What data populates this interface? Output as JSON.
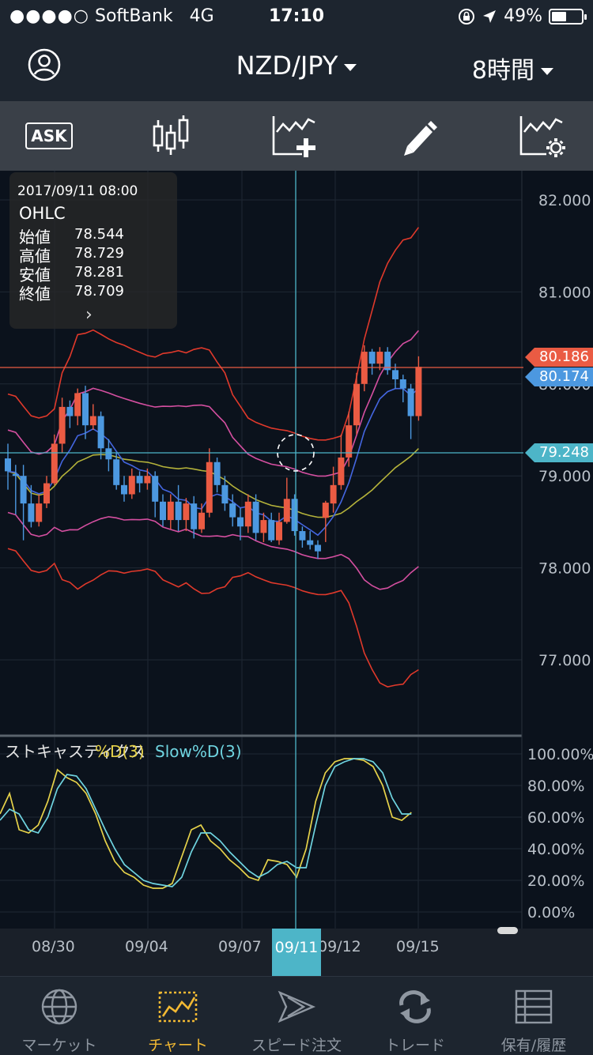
{
  "status": {
    "signal_dots": "●●●●○",
    "carrier": "SoftBank",
    "network": "4G",
    "time": "17:10",
    "battery": "49%",
    "battery_level": 0.49
  },
  "nav": {
    "pair": "NZD/JPY",
    "period": "8時間"
  },
  "toolbar": {
    "ask_label": "ASK"
  },
  "ohlc": {
    "datetime": "2017/09/11 08:00",
    "header": "OHLC",
    "rows": [
      {
        "label": "始値",
        "value": "78.544"
      },
      {
        "label": "高値",
        "value": "78.729"
      },
      {
        "label": "安値",
        "value": "78.281"
      },
      {
        "label": "終値",
        "value": "78.709"
      }
    ],
    "more": "›"
  },
  "price_axis": {
    "labels": [
      "82.000",
      "81.000",
      "80.000",
      "79.000",
      "78.000",
      "77.000"
    ]
  },
  "price_tags": {
    "bid": "80.186",
    "ask": "80.174",
    "crosshair": "79.248"
  },
  "stoch": {
    "title": "ストキャスティクス",
    "d_label": "%D(3)",
    "slow_label": "Slow%D(3)",
    "axis_labels": [
      "100.00%",
      "80.00%",
      "60.00%",
      "40.00%",
      "20.00%",
      "0.00%"
    ]
  },
  "xaxis": {
    "labels": [
      "08/30",
      "09/04",
      "09/07",
      "09/12",
      "09/15"
    ],
    "current": "09/11"
  },
  "tabs": [
    {
      "label": "マーケット"
    },
    {
      "label": "チャート"
    },
    {
      "label": "スピード注文"
    },
    {
      "label": "トレード"
    },
    {
      "label": "保有/履歴"
    }
  ],
  "colors": {
    "up": "#ea5b43",
    "down": "#4c98e0",
    "crosshair": "#4db5c8",
    "accent": "#f2b933",
    "stoch_d": "#e6d24a",
    "stoch_slow": "#6fd4e0"
  },
  "chart_data": [
    {
      "type": "candlestick",
      "title": "NZD/JPY",
      "ylim": [
        76.5,
        82.4
      ],
      "yticks": [
        82.0,
        81.0,
        80.0,
        79.0,
        78.0,
        77.0
      ],
      "xticks": [
        "08/30",
        "09/04",
        "09/07",
        "09/11",
        "09/12",
        "09/15"
      ],
      "candles": [
        [
          79.19,
          79.05,
          79.35,
          78.85
        ],
        [
          79.02,
          79.0,
          79.12,
          78.58
        ],
        [
          79.0,
          78.7,
          79.12,
          78.3
        ],
        [
          78.7,
          78.5,
          78.9,
          78.44
        ],
        [
          78.5,
          78.7,
          78.8,
          78.45
        ],
        [
          78.7,
          78.92,
          79.0,
          78.65
        ],
        [
          78.92,
          79.35,
          79.45,
          78.9
        ],
        [
          79.35,
          79.75,
          79.85,
          79.25
        ],
        [
          79.75,
          79.65,
          79.82,
          79.52
        ],
        [
          79.65,
          79.9,
          79.95,
          79.55
        ],
        [
          79.9,
          79.55,
          79.98,
          79.4
        ],
        [
          79.55,
          79.65,
          79.78,
          79.5
        ],
        [
          79.65,
          79.3,
          79.7,
          79.18
        ],
        [
          79.3,
          79.18,
          79.4,
          79.05
        ],
        [
          79.18,
          78.9,
          79.25,
          78.85
        ],
        [
          78.9,
          78.8,
          79.0,
          78.72
        ],
        [
          78.8,
          79.0,
          79.08,
          78.75
        ],
        [
          79.0,
          78.92,
          79.05,
          78.82
        ],
        [
          78.92,
          79.0,
          79.08,
          78.85
        ],
        [
          79.0,
          78.72,
          79.05,
          78.55
        ],
        [
          78.72,
          78.52,
          78.8,
          78.45
        ],
        [
          78.52,
          78.72,
          78.8,
          78.42
        ],
        [
          78.72,
          78.52,
          78.9,
          78.4
        ],
        [
          78.52,
          78.7,
          78.76,
          78.4
        ],
        [
          78.7,
          78.42,
          78.78,
          78.32
        ],
        [
          78.42,
          78.6,
          78.7,
          78.38
        ],
        [
          78.6,
          79.15,
          79.3,
          78.55
        ],
        [
          79.15,
          78.9,
          79.2,
          78.82
        ],
        [
          78.9,
          78.7,
          79.0,
          78.62
        ],
        [
          78.7,
          78.55,
          78.8,
          78.45
        ],
        [
          78.55,
          78.45,
          78.65,
          78.3
        ],
        [
          78.45,
          78.72,
          78.8,
          78.38
        ],
        [
          78.72,
          78.38,
          78.8,
          78.3
        ],
        [
          78.38,
          78.52,
          78.6,
          78.28
        ],
        [
          78.52,
          78.3,
          78.6,
          78.28
        ],
        [
          78.3,
          78.5,
          78.6,
          78.25
        ],
        [
          78.5,
          78.75,
          78.98,
          78.48
        ],
        [
          78.75,
          78.4,
          78.8,
          78.35
        ],
        [
          78.4,
          78.3,
          78.45,
          78.22
        ],
        [
          78.3,
          78.25,
          78.4,
          78.2
        ],
        [
          78.25,
          78.18,
          78.3,
          78.1
        ],
        [
          78.544,
          78.709,
          78.729,
          78.281
        ],
        [
          78.7,
          78.9,
          79.1,
          78.6
        ],
        [
          78.9,
          79.2,
          79.45,
          78.85
        ],
        [
          79.2,
          79.55,
          79.7,
          79.1
        ],
        [
          79.55,
          80.0,
          80.12,
          79.45
        ],
        [
          80.0,
          80.35,
          80.42,
          79.92
        ],
        [
          80.35,
          80.22,
          80.38,
          80.1
        ],
        [
          80.22,
          80.35,
          80.4,
          80.15
        ],
        [
          80.35,
          80.15,
          80.4,
          80.1
        ],
        [
          80.15,
          80.05,
          80.22,
          79.95
        ],
        [
          80.05,
          79.95,
          80.1,
          79.8
        ],
        [
          79.95,
          79.65,
          80.0,
          79.4
        ],
        [
          79.65,
          80.186,
          80.3,
          79.6
        ]
      ]
    },
    {
      "type": "line",
      "title": "ストキャスティクス",
      "ylim": [
        0,
        100
      ],
      "series": [
        {
          "name": "%D(3)",
          "values": [
            62,
            75,
            52,
            50,
            55,
            70,
            90,
            85,
            82,
            75,
            62,
            45,
            32,
            25,
            22,
            17,
            15,
            15,
            18,
            35,
            52,
            55,
            45,
            40,
            33,
            28,
            22,
            20,
            33,
            32,
            30,
            22,
            40,
            70,
            88,
            95,
            97,
            97,
            96,
            92,
            80,
            60,
            58,
            63
          ]
        },
        {
          "name": "Slow%D(3)",
          "values": [
            58,
            65,
            62,
            52,
            50,
            60,
            78,
            87,
            86,
            78,
            65,
            52,
            40,
            30,
            25,
            20,
            18,
            17,
            16,
            22,
            38,
            50,
            50,
            45,
            38,
            32,
            26,
            22,
            25,
            30,
            32,
            28,
            28,
            55,
            80,
            92,
            95,
            97,
            97,
            95,
            88,
            72,
            62,
            62
          ]
        }
      ]
    }
  ]
}
